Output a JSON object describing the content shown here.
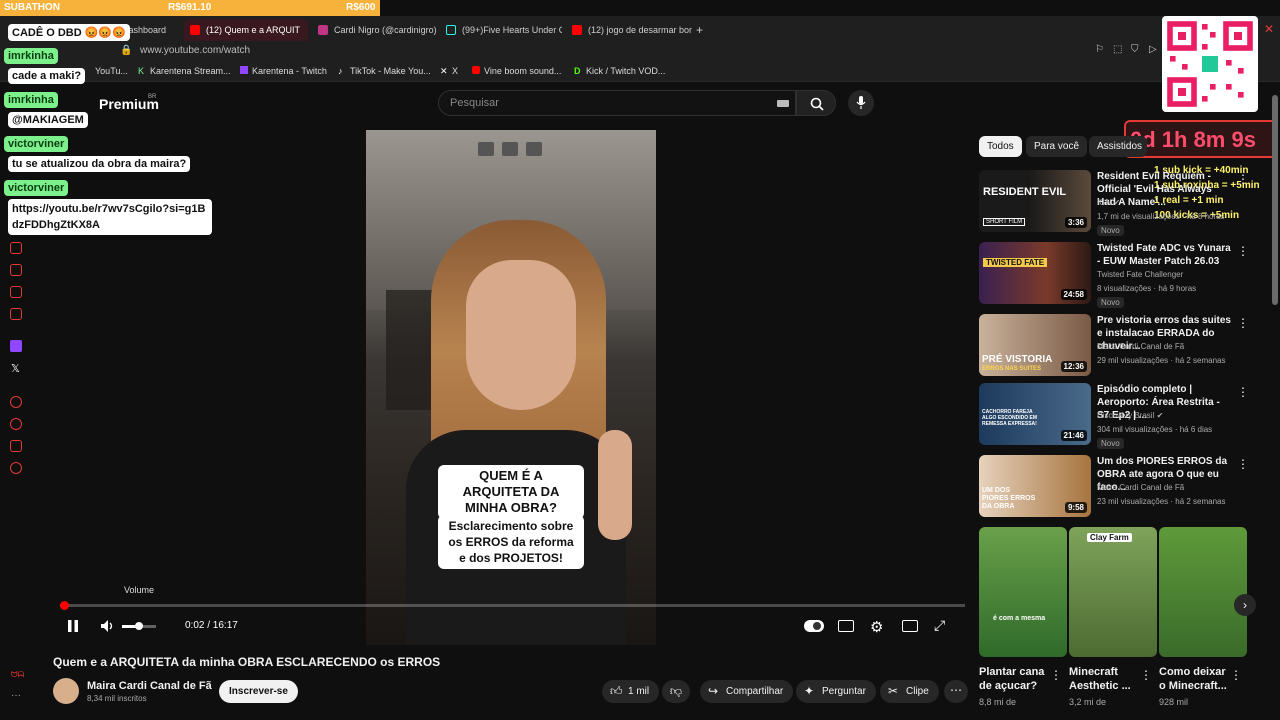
{
  "overlay": {
    "subathon_label": "SUBATHON",
    "amount_raised": "R$691.10",
    "amount_goal": "R$600",
    "timer": "0d 1h 8m 9s",
    "rules": [
      "1 sub kick = +40min",
      "1 sub roxinha = +5min",
      "1 real = +1 min",
      "100 kicks = +5min"
    ]
  },
  "browser": {
    "tabs": [
      {
        "label": "Dashboard",
        "active": false
      },
      {
        "label": "(12) Quem e a ARQUIT",
        "active": true
      },
      {
        "label": "Cardi Nigro (@cardinigro)",
        "active": false
      },
      {
        "label": "(99+)Five Hearts Under O",
        "active": false
      },
      {
        "label": "(12) jogo de desarmar bom",
        "active": false
      }
    ],
    "new_tab_label": "+",
    "url": "www.youtube.com/watch",
    "bookmarks": [
      "YouTu...",
      "Karentena Stream...",
      "Karentena - Twitch",
      "TikTok - Make You...",
      "X",
      "Vine boom sound...",
      "Kick / Twitch VOD..."
    ]
  },
  "chat": {
    "messages": [
      {
        "user": "",
        "text": "CADÊ O DBD 😡😡😡"
      },
      {
        "user": "imrkinha",
        "text": "cade a maki?"
      },
      {
        "user": "imrkinha",
        "text": "@MAKIAGEM"
      },
      {
        "user": "victorviner",
        "text": "tu se atualizou da obra da maira?"
      },
      {
        "user": "victorviner",
        "text": "https://youtu.be/r7wv7sCgilo?si=g1BdzFDDhgZtKX8A"
      }
    ]
  },
  "youtube": {
    "logo_suffix": "Premium",
    "logo_region": "BR",
    "search_placeholder": "Pesquisar",
    "player": {
      "caption_question": "QUEM É A ARQUITETA DA MINHA OBRA?",
      "caption_answer": "Esclarecimento sobre os ERROS da reforma e dos PROJETOS!",
      "volume_tooltip": "Volume",
      "time": "0:02 / 16:17",
      "progress": 0.002
    },
    "video_title": "Quem e a ARQUITETA da minha OBRA ESCLARECENDO os ERROS",
    "channel_name": "Maira Cardi Canal de Fã",
    "subscribers": "8,34 mil inscritos",
    "subscribe_label": "Inscrever-se",
    "actions": {
      "likes": "1 mil",
      "share": "Compartilhar",
      "ask": "Perguntar",
      "clip": "Clipe"
    },
    "filter_chips": [
      "Todos",
      "Para você",
      "Assistidos"
    ],
    "recommendations": [
      {
        "title": "Resident Evil Requiem - Official 'Evil Has Always Had A Name'...",
        "channel": "IGN",
        "meta": "1,7 mi de visualizações · há 8 horas",
        "duration": "3:36",
        "new": "Novo",
        "thumb_color": "#3a3a3a"
      },
      {
        "title": "Twisted Fate ADC vs Yunara - EUW Master Patch 26.03",
        "channel": "Twisted Fate Challenger",
        "meta": "8 visualizações · há 9 horas",
        "duration": "24:58",
        "new": "Novo",
        "thumb_color": "#6b2a2a"
      },
      {
        "title": "Pre vistoria erros das suites e instalacao ERRADA do chuveir...",
        "channel": "Maira Cardi Canal de Fã",
        "meta": "29 mil visualizações · há 2 semanas",
        "duration": "12:36",
        "new": "",
        "thumb_color": "#8a6b5a"
      },
      {
        "title": "Episódio completo | Aeroporto: Área Restrita - S7 Ep2 | ...",
        "channel": "Discovery Brasil",
        "meta": "304 mil visualizações · há 6 dias",
        "duration": "21:46",
        "new": "Novo",
        "thumb_color": "#27466b"
      },
      {
        "title": "Um dos PIORES ERROS da OBRA ate agora O que eu faco...",
        "channel": "Maira Cardi Canal de Fã",
        "meta": "23 mil visualizações · há 2 semanas",
        "duration": "9:58",
        "new": "",
        "thumb_color": "#b07a4a"
      }
    ],
    "shorts": [
      {
        "title": "Plantar cana de açucar?",
        "views": "8,8 mi de",
        "overlay": "é com a mesma"
      },
      {
        "title": "Minecraft Aesthetic ...",
        "views": "3,2 mi de",
        "overlay": "Clay Farm"
      },
      {
        "title": "Como deixar o Minecraft...",
        "views": "928 mil",
        "overlay": ""
      }
    ],
    "thumb_texts": {
      "re_label": "RESIDENT EVIL",
      "re_sub": "SHORT FILM",
      "tf_label": "TWISTED FATE",
      "pv_label": "PRÉ VISTORIA",
      "pv_sub": "ERROS NAS SUITES",
      "ep_label": "CACHORRO FAREJA ALGO ESCONDIDO EM REMESSA EXPRESSA!",
      "ob_label": "UM DOS PIORES ERROS DA OBRA"
    }
  },
  "colors": {
    "accent": "#e53935",
    "chat_user": "#7cf08a",
    "subathon": "#f7b23b"
  }
}
